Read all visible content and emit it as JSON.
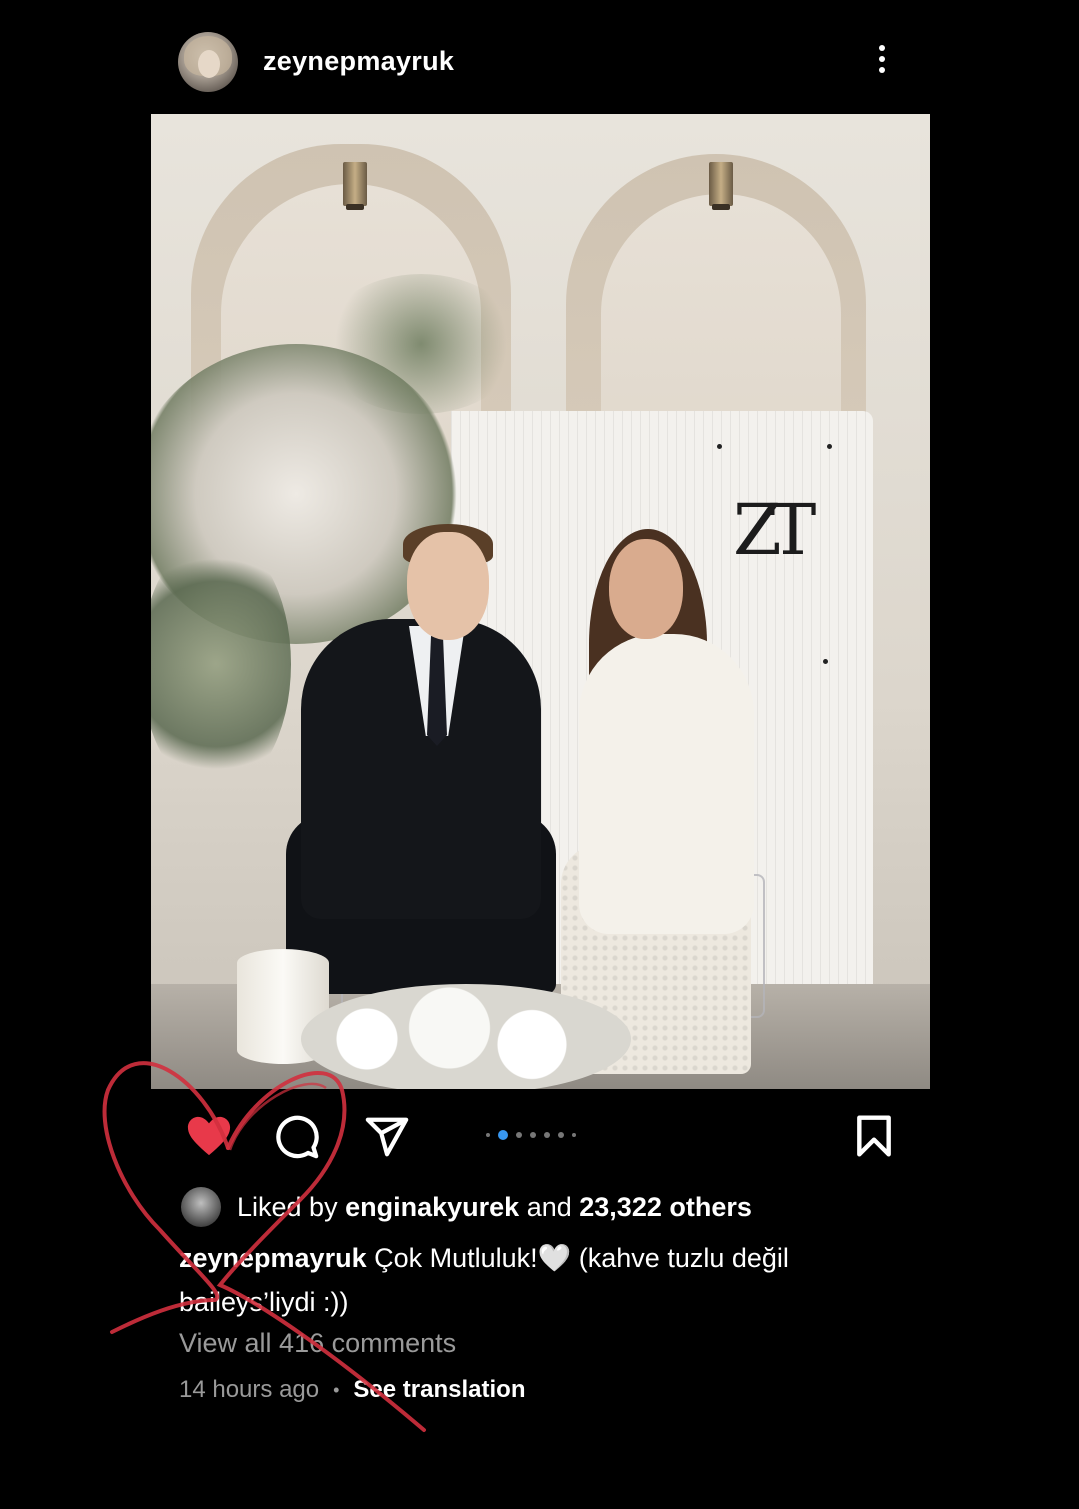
{
  "post": {
    "username": "zeynepmayruk",
    "photo_monogram": "ZT"
  },
  "actions": {
    "like_icon": "heart-filled-icon",
    "comment_icon": "comment-icon",
    "share_icon": "send-icon",
    "save_icon": "bookmark-icon",
    "carousel_count": 7,
    "carousel_active_index": 1
  },
  "likes": {
    "prefix": "Liked by",
    "liker": "enginakyurek",
    "connector": "and",
    "others": "23,322 others"
  },
  "caption": {
    "username": "zeynepmayruk",
    "text": "Çok Mutluluk!🤍 (kahve tuzlu değil baileys’liydi :))"
  },
  "comments_link": "View all 416 comments",
  "meta": {
    "time": "14 hours ago",
    "separator": "•",
    "translate": "See translation"
  },
  "colors": {
    "background": "#000000",
    "like_red": "#e8394a",
    "carousel_active": "#3897f0",
    "muted_text": "#9a9a9a",
    "overlay_scribble": "#d2303e"
  }
}
